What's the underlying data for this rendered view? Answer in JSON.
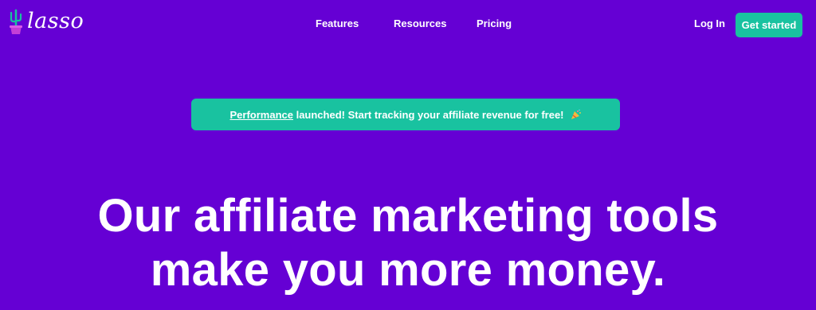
{
  "brand": {
    "name": "lasso",
    "logo_icon": "cactus-pot-icon",
    "background_color": "#6500d4",
    "accent_color": "#19c2a0"
  },
  "nav": {
    "links": [
      {
        "label": "Features"
      },
      {
        "label": "Resources"
      },
      {
        "label": "Pricing"
      }
    ],
    "login_label": "Log In",
    "cta_label": "Get started"
  },
  "banner": {
    "link_text": "Performance",
    "text": " launched! Start tracking your affiliate revenue for free!",
    "icon": "party-popper-icon"
  },
  "hero": {
    "line1": "Our affiliate marketing tools",
    "line2": "make you more money."
  }
}
